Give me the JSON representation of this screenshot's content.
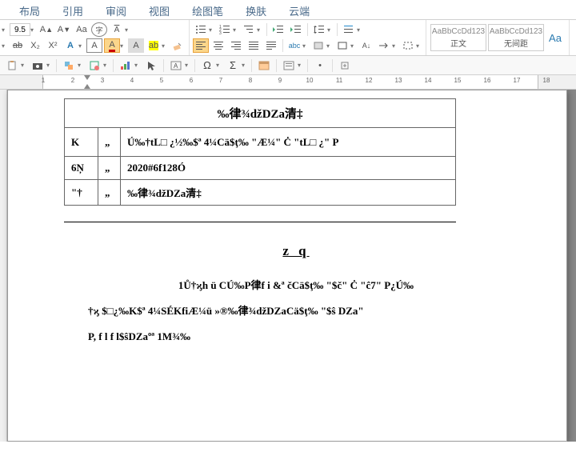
{
  "tabs": [
    "布局",
    "引用",
    "审阅",
    "视图",
    "绘图笔",
    "换肤",
    "云端"
  ],
  "font": {
    "size": "9.5"
  },
  "styles": [
    {
      "sample": "AaBbCcDd123",
      "name": "正文"
    },
    {
      "sample": "AaBbCcDd123",
      "name": "无间距"
    },
    {
      "sample": "Aa",
      "name": ""
    }
  ],
  "ribbon": {
    "row1_icons": [
      "bullets",
      "numbering",
      "multilevel",
      "indent-left",
      "indent-right",
      "line-spacing",
      "para-settings"
    ],
    "row2_icons": [
      "align-left",
      "align-center",
      "align-right",
      "justify",
      "distribute",
      "shading",
      "borders",
      "sort",
      "show-marks",
      "dropcap"
    ]
  },
  "qat_icons": [
    "paste",
    "camera",
    "select",
    "shapes",
    "screenshot",
    "chart",
    "text-tool",
    "format-tool",
    "date",
    "omega",
    "math-sigma",
    "form",
    "link",
    "symbol-mid",
    "dot",
    "dropdown"
  ],
  "ruler": {
    "start": 1,
    "end": 18
  },
  "document": {
    "table": {
      "title": "‰律¾džDZa清‡",
      "rows": [
        {
          "c1": "K",
          "c2": "„",
          "c3": "Ú‰†tL□ ¿½‰$ª 4¼Cä$ţ‰ \"Æ¼\" Ċ \"tL□ ¿\" P"
        },
        {
          "c1": "6Ņ",
          "c2": "„",
          "c3": "2020#6f128Ó"
        },
        {
          "c1": "\"†",
          "c2": "„",
          "c3": "‰律¾džDZa清‡"
        }
      ]
    },
    "title": "z q",
    "paragraphs": [
      "1Ů†ϗh ü CÚ‰P律f i &ª čCä$ţ‰ \"$č\" Ċ \"ĉ7\" P¿Ú‰",
      "†ϗ $□¿‰K$ª 4¼SÉKfiÆ¼ü »®‰律¾džDZaCä$ţ‰ \"$ŝ   DZa\"",
      "P, f l f l$ŝDZaºª 1M¾‰"
    ]
  }
}
